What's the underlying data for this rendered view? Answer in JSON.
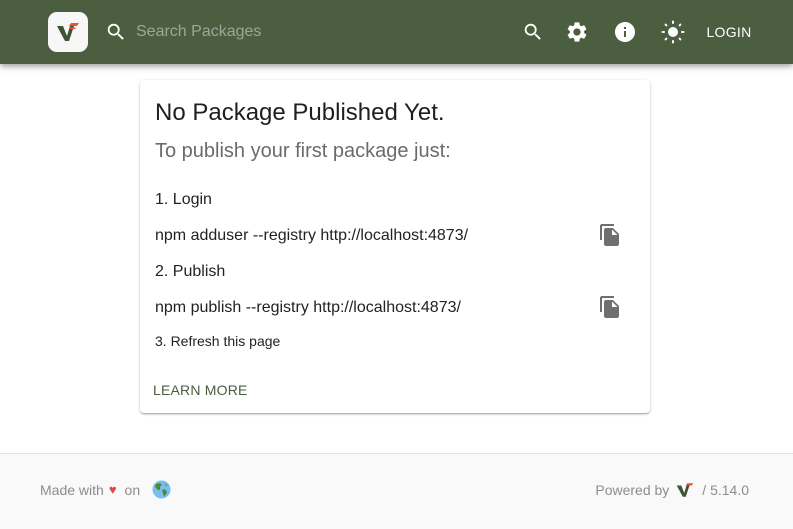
{
  "header": {
    "brand_icon": "verdaccio-logo-icon",
    "search": {
      "placeholder": "Search Packages",
      "value": ""
    },
    "actions": [
      {
        "name": "search",
        "icon": "search-icon"
      },
      {
        "name": "settings",
        "icon": "gear-icon"
      },
      {
        "name": "info",
        "icon": "info-icon"
      },
      {
        "name": "theme",
        "icon": "sun-icon"
      }
    ],
    "login_label": "LOGIN"
  },
  "card": {
    "title": "No Package Published Yet.",
    "subtitle": "To publish your first package just:",
    "steps": [
      {
        "label": "1. Login",
        "command": "npm adduser --registry http://localhost:4873/",
        "copy_icon": "copy-icon"
      },
      {
        "label": "2. Publish",
        "command": "npm publish --registry http://localhost:4873/",
        "copy_icon": "copy-icon"
      }
    ],
    "step3": "3. Refresh this page",
    "learn_more": "LEARN MORE"
  },
  "footer": {
    "made_with": "Made with",
    "heart": "♥",
    "on": "on",
    "globe_icon": "globe-icon",
    "powered_by": "Powered by",
    "version": "/ 5.14.0"
  },
  "colors": {
    "primary": "#4b5e40",
    "accent": "#e4572e",
    "heart": "#e04848"
  }
}
